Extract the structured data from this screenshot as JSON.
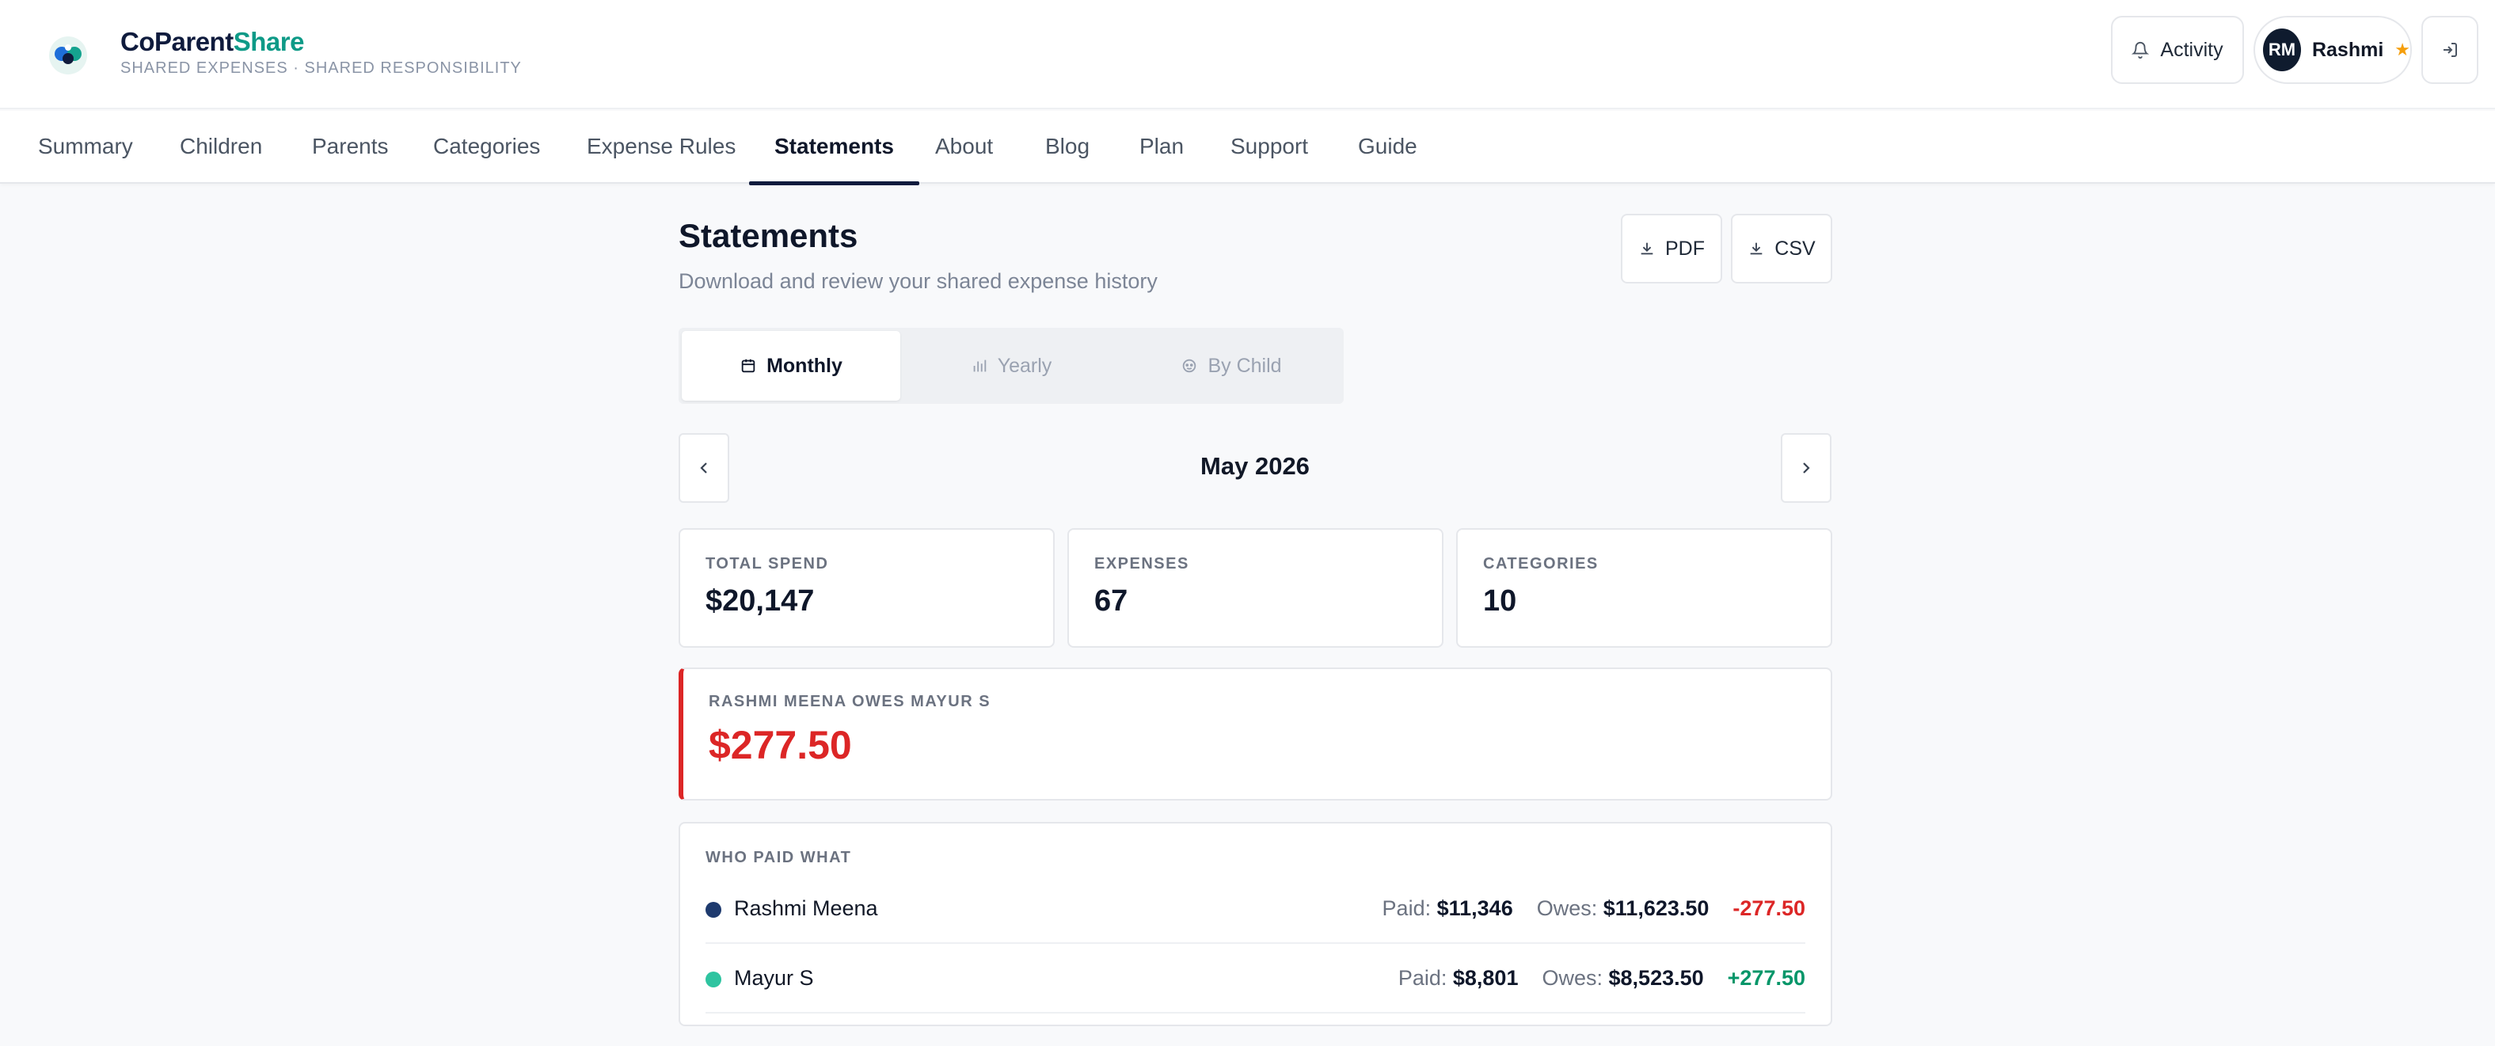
{
  "brand": {
    "name_part1": "CoParent",
    "name_part2": "Share",
    "tagline": "SHARED EXPENSES · SHARED RESPONSIBILITY"
  },
  "header": {
    "activity_label": "Activity",
    "user_initials": "RM",
    "user_name": "Rashmi",
    "user_star": "★"
  },
  "nav": {
    "items": [
      "Summary",
      "Children",
      "Parents",
      "Categories",
      "Expense Rules",
      "Statements",
      "About",
      "Blog",
      "Plan",
      "Support",
      "Guide"
    ],
    "active": "Statements"
  },
  "page": {
    "title": "Statements",
    "subtitle": "Download and review your shared expense history",
    "pdf_label": "PDF",
    "csv_label": "CSV"
  },
  "tabs": [
    {
      "label": "Monthly",
      "icon": "calendar-icon",
      "active": true
    },
    {
      "label": "Yearly",
      "icon": "bar-chart-icon",
      "active": false
    },
    {
      "label": "By Child",
      "icon": "child-icon",
      "active": false
    }
  ],
  "period": {
    "label": "May 2026"
  },
  "stats": [
    {
      "label": "TOTAL SPEND",
      "value": "$20,147"
    },
    {
      "label": "EXPENSES",
      "value": "67"
    },
    {
      "label": "CATEGORIES",
      "value": "10"
    }
  ],
  "balance": {
    "label": "RASHMI MEENA OWES MAYUR S",
    "amount": "$277.50",
    "color": "#dc2626"
  },
  "who_paid": {
    "title": "WHO PAID WHAT",
    "paid_prefix": "Paid:",
    "owes_prefix": "Owes:",
    "rows": [
      {
        "name": "Rashmi Meena",
        "dot_color": "#1e3a6e",
        "paid": "$11,346",
        "owes": "$11,623.50",
        "net": "-277.50",
        "net_color": "#dc2626"
      },
      {
        "name": "Mayur S",
        "dot_color": "#2ec4a0",
        "paid": "$8,801",
        "owes": "$8,523.50",
        "net": "+277.50",
        "net_color": "#059669"
      }
    ]
  }
}
